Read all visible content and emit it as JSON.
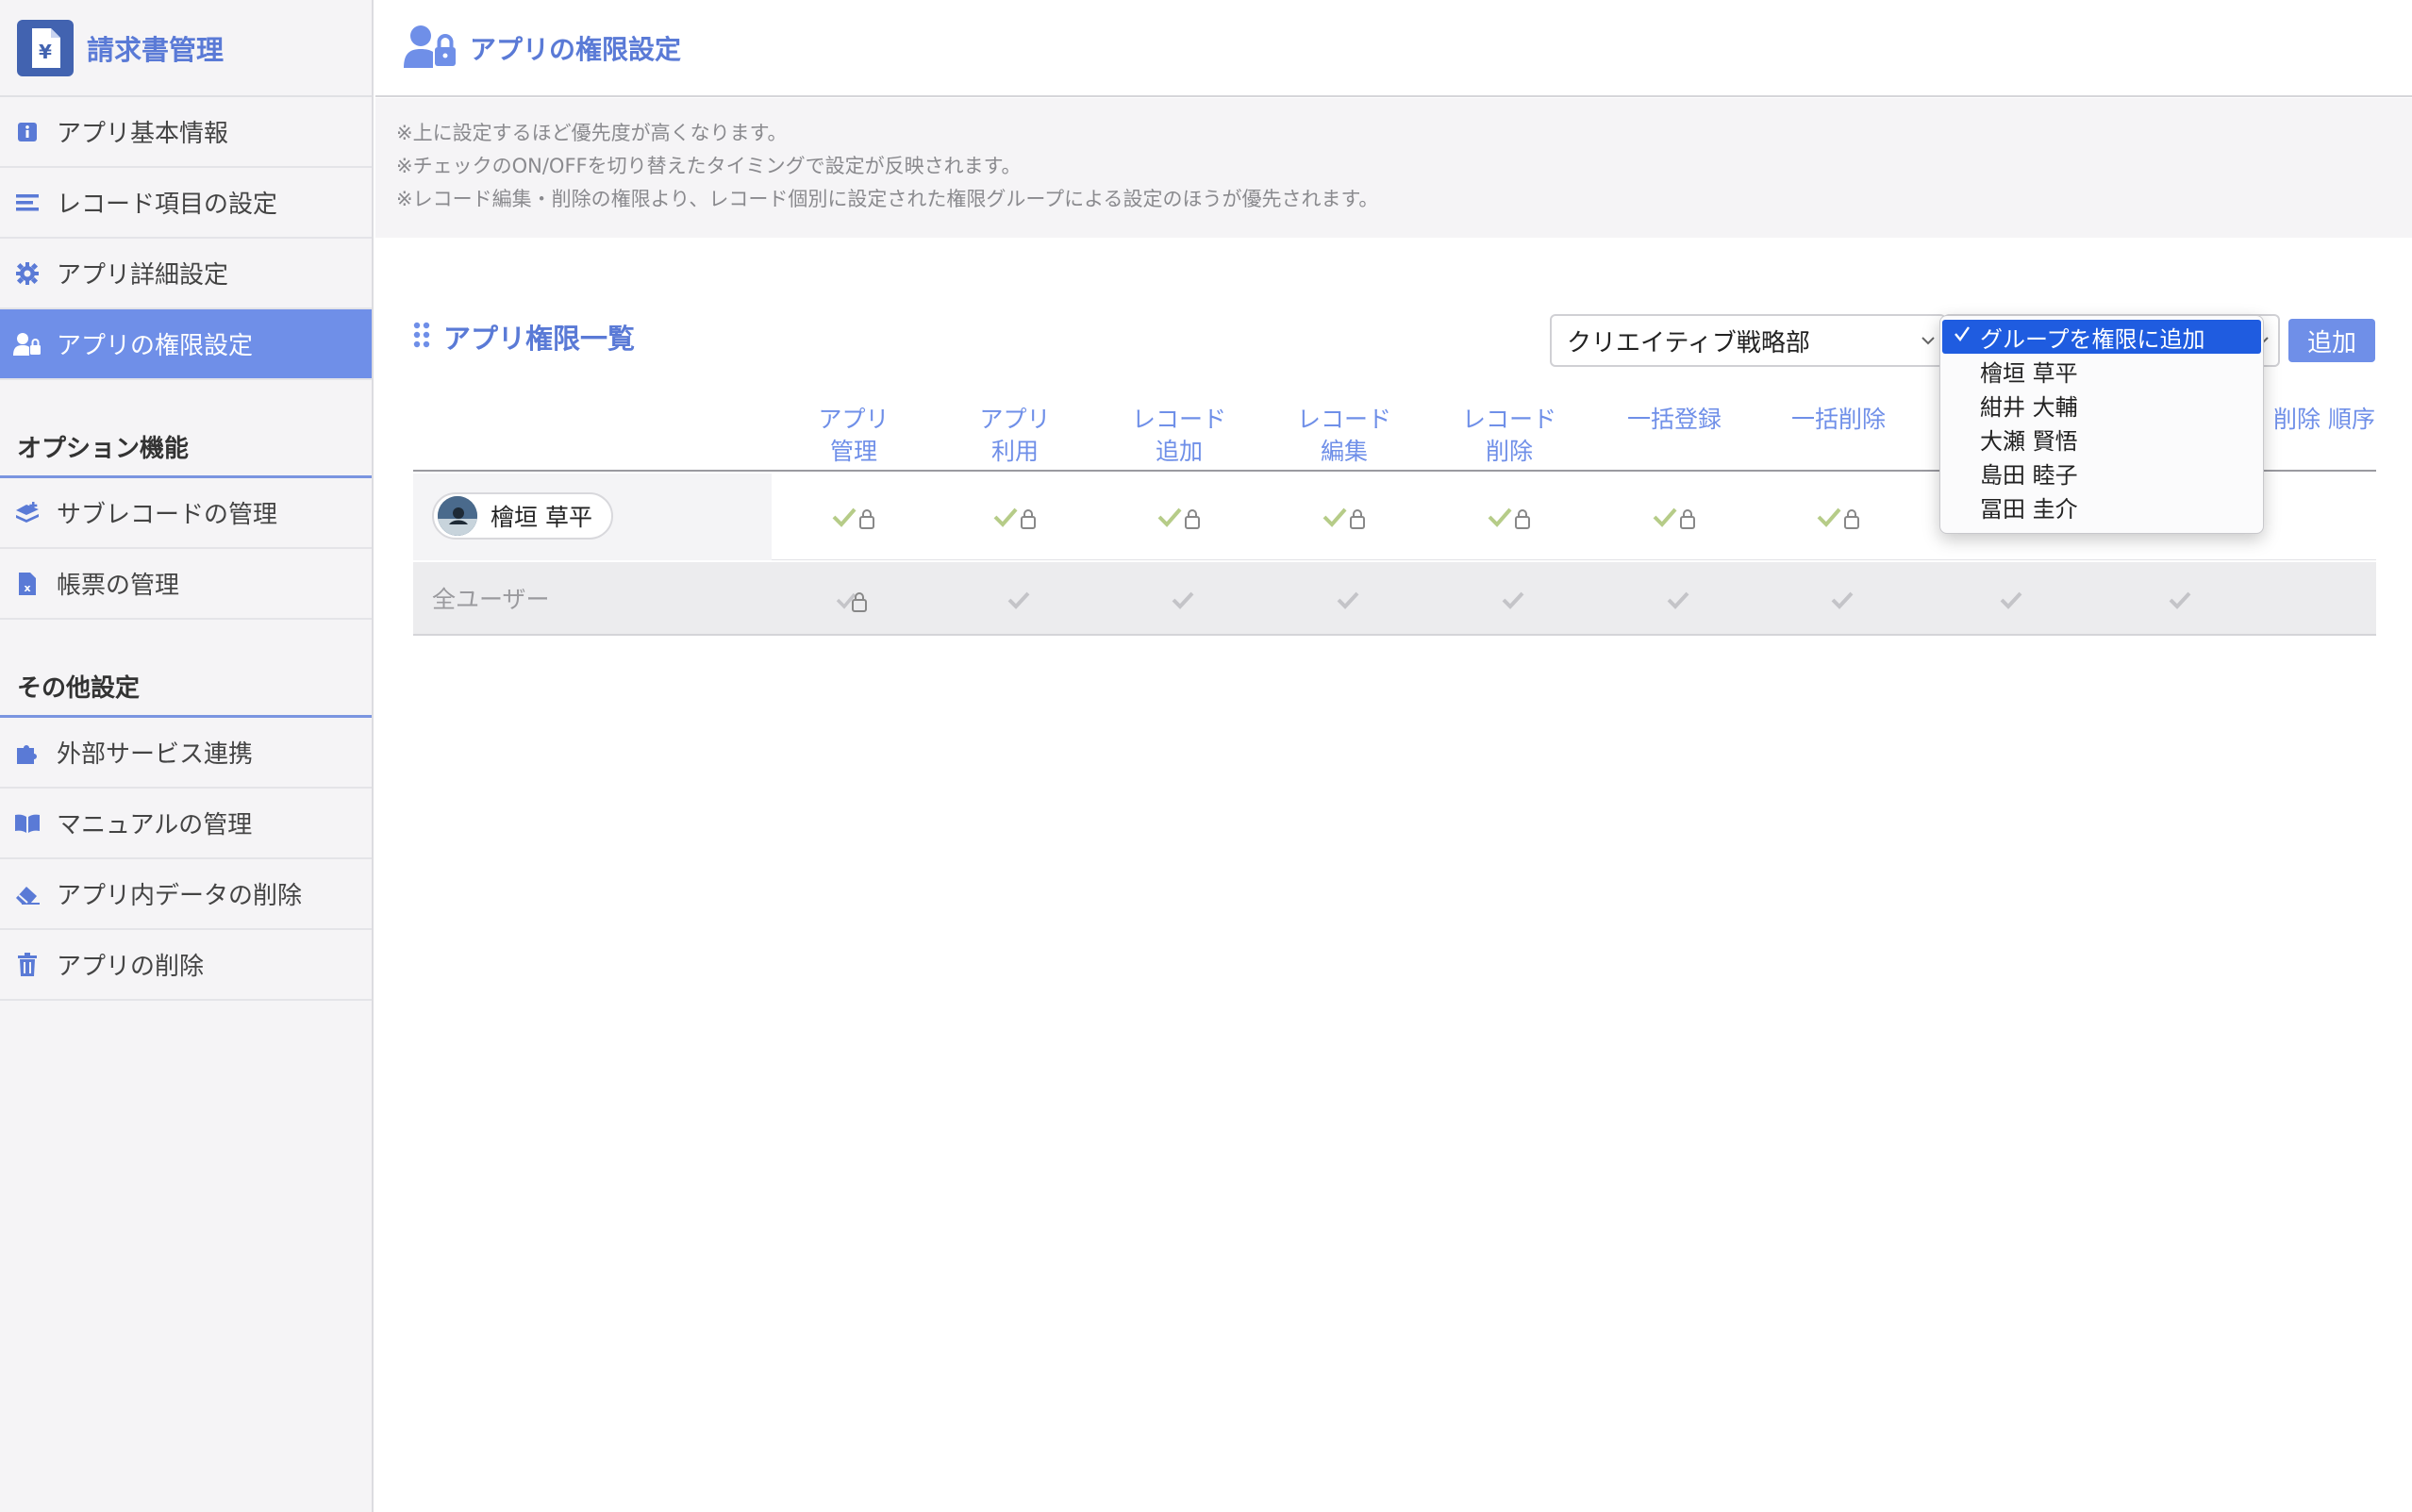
{
  "app": {
    "title": "請求書管理",
    "logo_symbol": "¥"
  },
  "sidebar": {
    "items": [
      {
        "label": "アプリ基本情報",
        "icon": "info-icon"
      },
      {
        "label": "レコード項目の設定",
        "icon": "list-icon"
      },
      {
        "label": "アプリ詳細設定",
        "icon": "gear-icon"
      },
      {
        "label": "アプリの権限設定",
        "icon": "user-lock-icon",
        "active": true
      }
    ],
    "option_title": "オプション機能",
    "option_items": [
      {
        "label": "サブレコードの管理",
        "icon": "layers-icon"
      },
      {
        "label": "帳票の管理",
        "icon": "excel-file-icon"
      }
    ],
    "other_title": "その他設定",
    "other_items": [
      {
        "label": "外部サービス連携",
        "icon": "puzzle-icon"
      },
      {
        "label": "マニュアルの管理",
        "icon": "book-icon"
      },
      {
        "label": "アプリ内データの削除",
        "icon": "eraser-icon"
      },
      {
        "label": "アプリの削除",
        "icon": "trash-icon"
      }
    ]
  },
  "header": {
    "title": "アプリの権限設定"
  },
  "notice": {
    "line1": "※上に設定するほど優先度が高くなります。",
    "line2": "※チェックのON/OFFを切り替えたタイミングで設定が反映されます。",
    "line3": "※レコード編集・削除の権限より、レコード個別に設定された権限グループによる設定のほうが優先されます。"
  },
  "main": {
    "list_title": "アプリ権限一覧",
    "group_select_value": "クリエイティブ戦略部",
    "add_button": "追加",
    "dropdown": {
      "selected": "グループを権限に追加",
      "options": [
        "檜垣 草平",
        "紺井 大輔",
        "大瀬 賢悟",
        "島田 睦子",
        "冨田 圭介"
      ]
    },
    "columns": [
      {
        "line1": "アプリ",
        "line2": "管理"
      },
      {
        "line1": "アプリ",
        "line2": "利用"
      },
      {
        "line1": "レコード",
        "line2": "追加"
      },
      {
        "line1": "レコード",
        "line2": "編集"
      },
      {
        "line1": "レコード",
        "line2": "削除"
      },
      {
        "line1": "一括登録",
        "line2": ""
      },
      {
        "line1": "一括削除",
        "line2": ""
      }
    ],
    "extra_headers": "削除 順序",
    "rows": [
      {
        "name": "檜垣 草平"
      },
      {
        "name": "全ユーザー"
      }
    ]
  },
  "colors": {
    "accent": "#6f8fe8",
    "title_blue": "#5a7ad6",
    "check_green": "#b6cc88",
    "check_gray": "#c4c4c8",
    "dropdown_selected": "#1f5ce0"
  }
}
